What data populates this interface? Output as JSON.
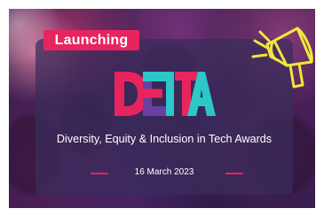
{
  "banner": {
    "badge_label": "Launching",
    "logo_text": "DEITA",
    "subtitle": "Diversity, Equity & Inclusion in Tech Awards",
    "date": "16 March 2023"
  },
  "icons": {
    "megaphone": "megaphone-icon"
  },
  "colors": {
    "accent_pink": "#e8245f",
    "logo_teal": "#2cc7c9",
    "logo_red": "#e8245f",
    "logo_purple": "#6b3fa0",
    "megaphone_yellow": "#f2e63a",
    "card_overlay": "#3a2c5c"
  }
}
